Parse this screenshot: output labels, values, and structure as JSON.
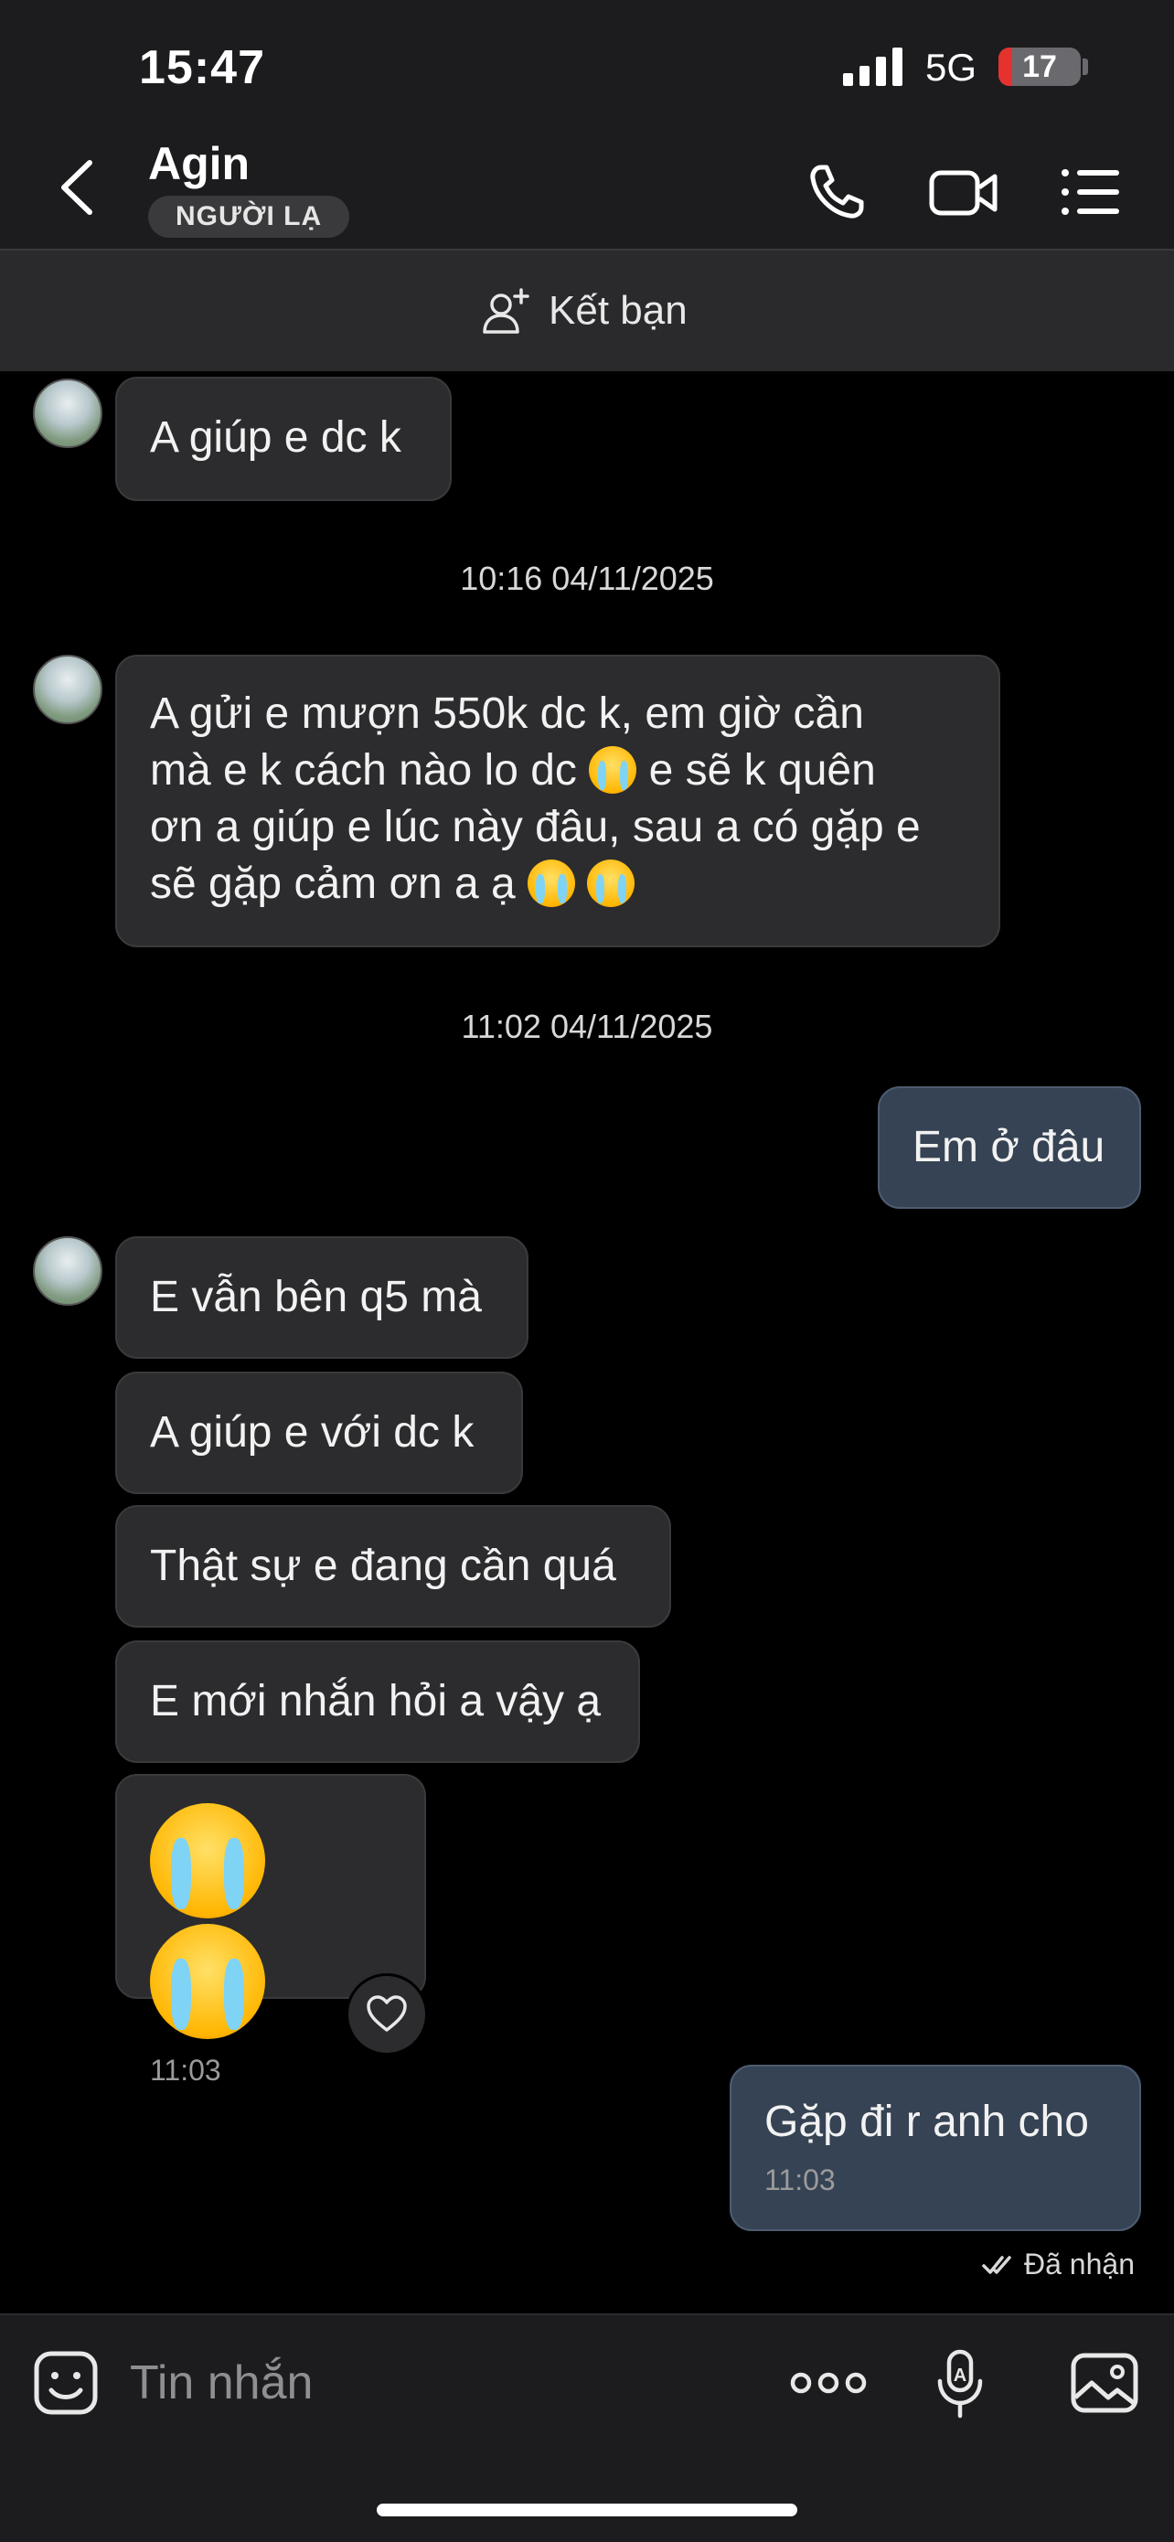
{
  "status_bar": {
    "time": "15:47",
    "network": "5G",
    "battery": "17",
    "battery_level": 0.17
  },
  "header": {
    "contact_name": "Agin",
    "badge": "NGƯỜI LẠ"
  },
  "friend_bar": {
    "label": "Kết bạn"
  },
  "messages": {
    "m1": "A giúp e dc k",
    "ts1": "10:16 04/11/2025",
    "m2_l1": "A gửi e mượn 550k dc k, em giờ cần",
    "m2_l2a": "mà e k cách nào lo dc",
    "m2_l2b": " e sẽ k quên",
    "m2_l3": "ơn a giúp e lúc này đâu, sau a có gặp e",
    "m2_l4": "sẽ gặp cảm ơn a ạ",
    "ts2": "11:02 04/11/2025",
    "m3": "Em ở đâu",
    "m4": "E vẫn bên q5 mà",
    "m5": "A giúp e với dc k",
    "m6": "Thật sự e đang cần quá",
    "m7": "E mới nhắn hỏi a vậy ạ",
    "m8_time": "11:03",
    "m9": "Gặp đi r anh cho",
    "m9_time": "11:03",
    "status": "Đã nhận"
  },
  "composer": {
    "placeholder": "Tin nhắn"
  },
  "icons": [
    "back-icon",
    "phone-icon",
    "video-icon",
    "menu-icon",
    "add-friend-icon",
    "emoji-icon",
    "more-icon",
    "voice-icon",
    "image-icon",
    "heart-icon",
    "double-check-icon",
    "crying-emoji"
  ]
}
